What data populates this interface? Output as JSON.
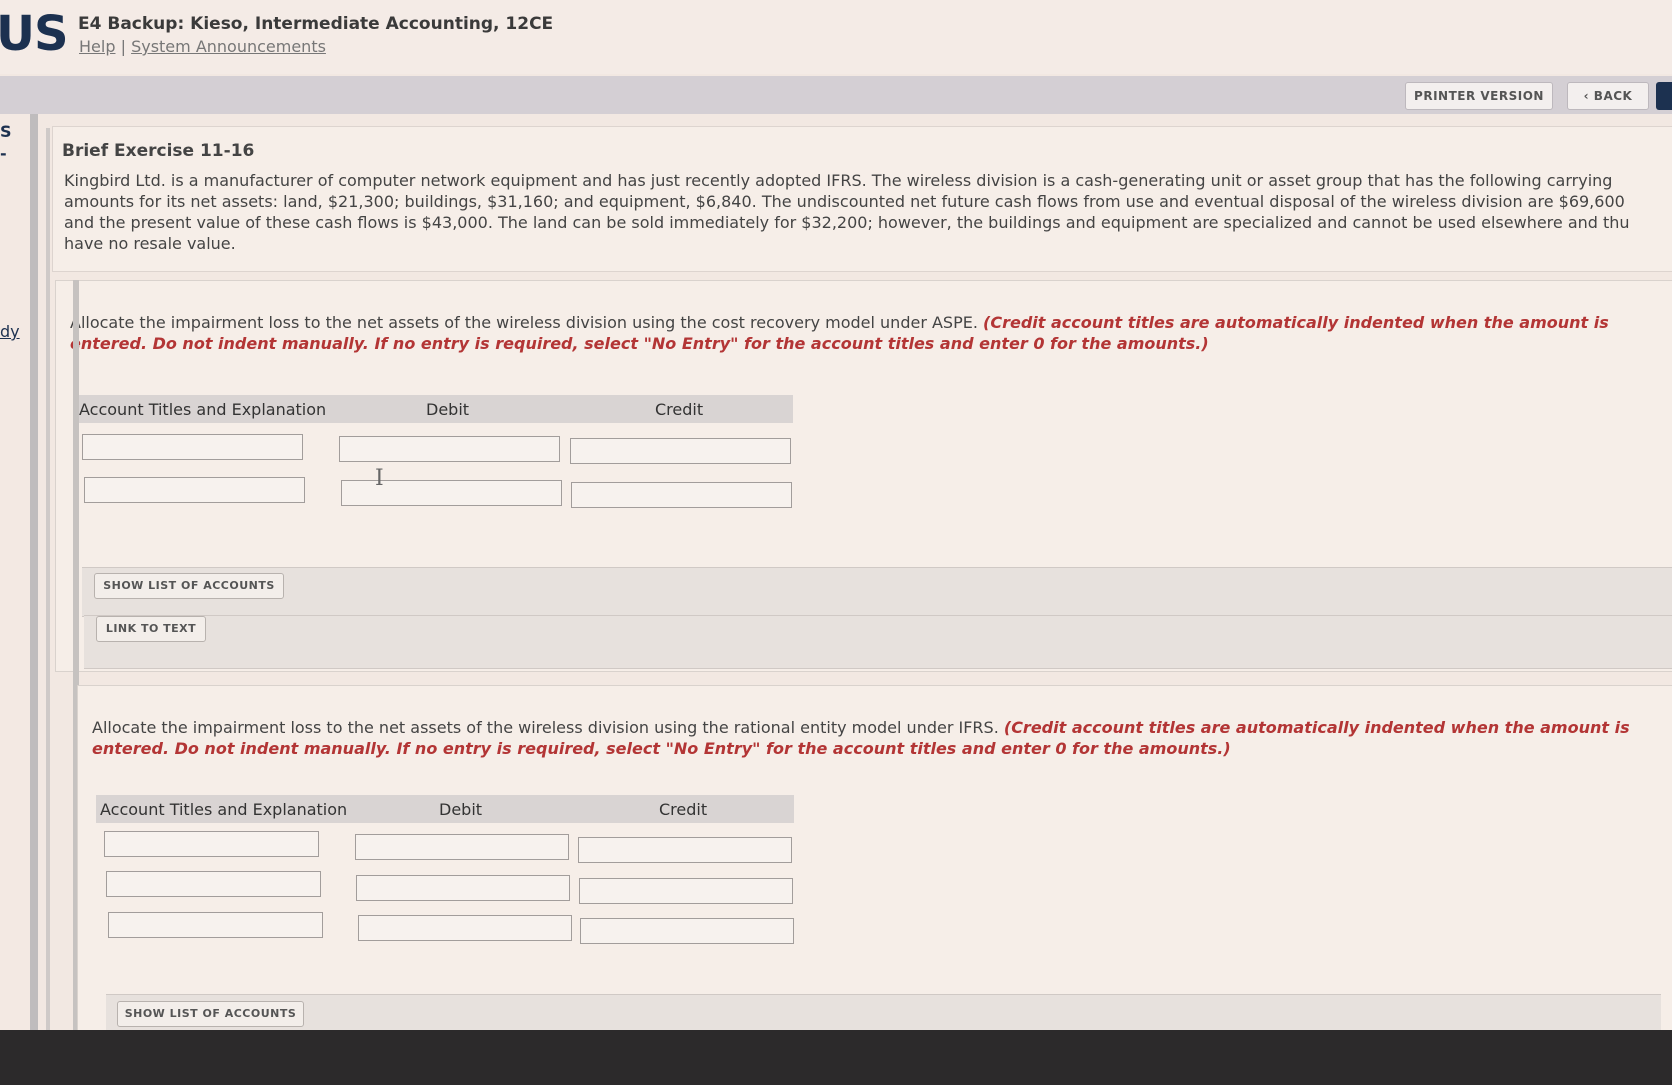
{
  "header": {
    "logo_text": "US",
    "course_title": "E4 Backup: Kieso, Intermediate Accounting, 12CE",
    "help_link": "Help",
    "separator": "|",
    "announcements_link": "System Announcements"
  },
  "toolbar": {
    "printer_label": "PRINTER VERSION",
    "back_label": "BACK"
  },
  "left_strip": {
    "fragment_1": "S",
    "fragment_2": "-",
    "fragment_3": "dy"
  },
  "exercise": {
    "title": "Brief Exercise 11-16",
    "text": "Kingbird Ltd. is a manufacturer of computer network equipment and has just recently adopted IFRS. The wireless division is a cash-generating unit or asset group that has the following carrying\namounts for its net assets: land, $21,300; buildings, $31,160; and equipment, $6,840. The undiscounted net future cash flows from use and eventual disposal of the wireless division are $69,600\nand the present value of these cash flows is $43,000. The land can be sold immediately for $32,200; however, the buildings and equipment are specialized and cannot be used elsewhere and thu\nhave no resale value."
  },
  "part1": {
    "instruction": "Allocate the impairment loss to the net assets of the wireless division using the cost recovery model under ASPE.",
    "note": "(Credit account titles are automatically indented when the amount is entered. Do not indent manually. If no entry is required, select \"No Entry\" for the account titles and enter 0 for the amounts.)",
    "columns": {
      "account": "Account Titles and Explanation",
      "debit": "Debit",
      "credit": "Credit"
    },
    "show_accounts_label": "SHOW LIST OF ACCOUNTS",
    "link_text_label": "LINK TO TEXT"
  },
  "part2": {
    "instruction": "Allocate the impairment loss to the net assets of the wireless division using the rational entity model under IFRS.",
    "note": "(Credit account titles are automatically indented when the amount is entered. Do not indent manually. If no entry is required, select \"No Entry\" for the account titles and enter 0 for the amounts.)",
    "columns": {
      "account": "Account Titles and Explanation",
      "debit": "Debit",
      "credit": "Credit"
    },
    "show_accounts_label": "SHOW LIST OF ACCOUNTS"
  }
}
